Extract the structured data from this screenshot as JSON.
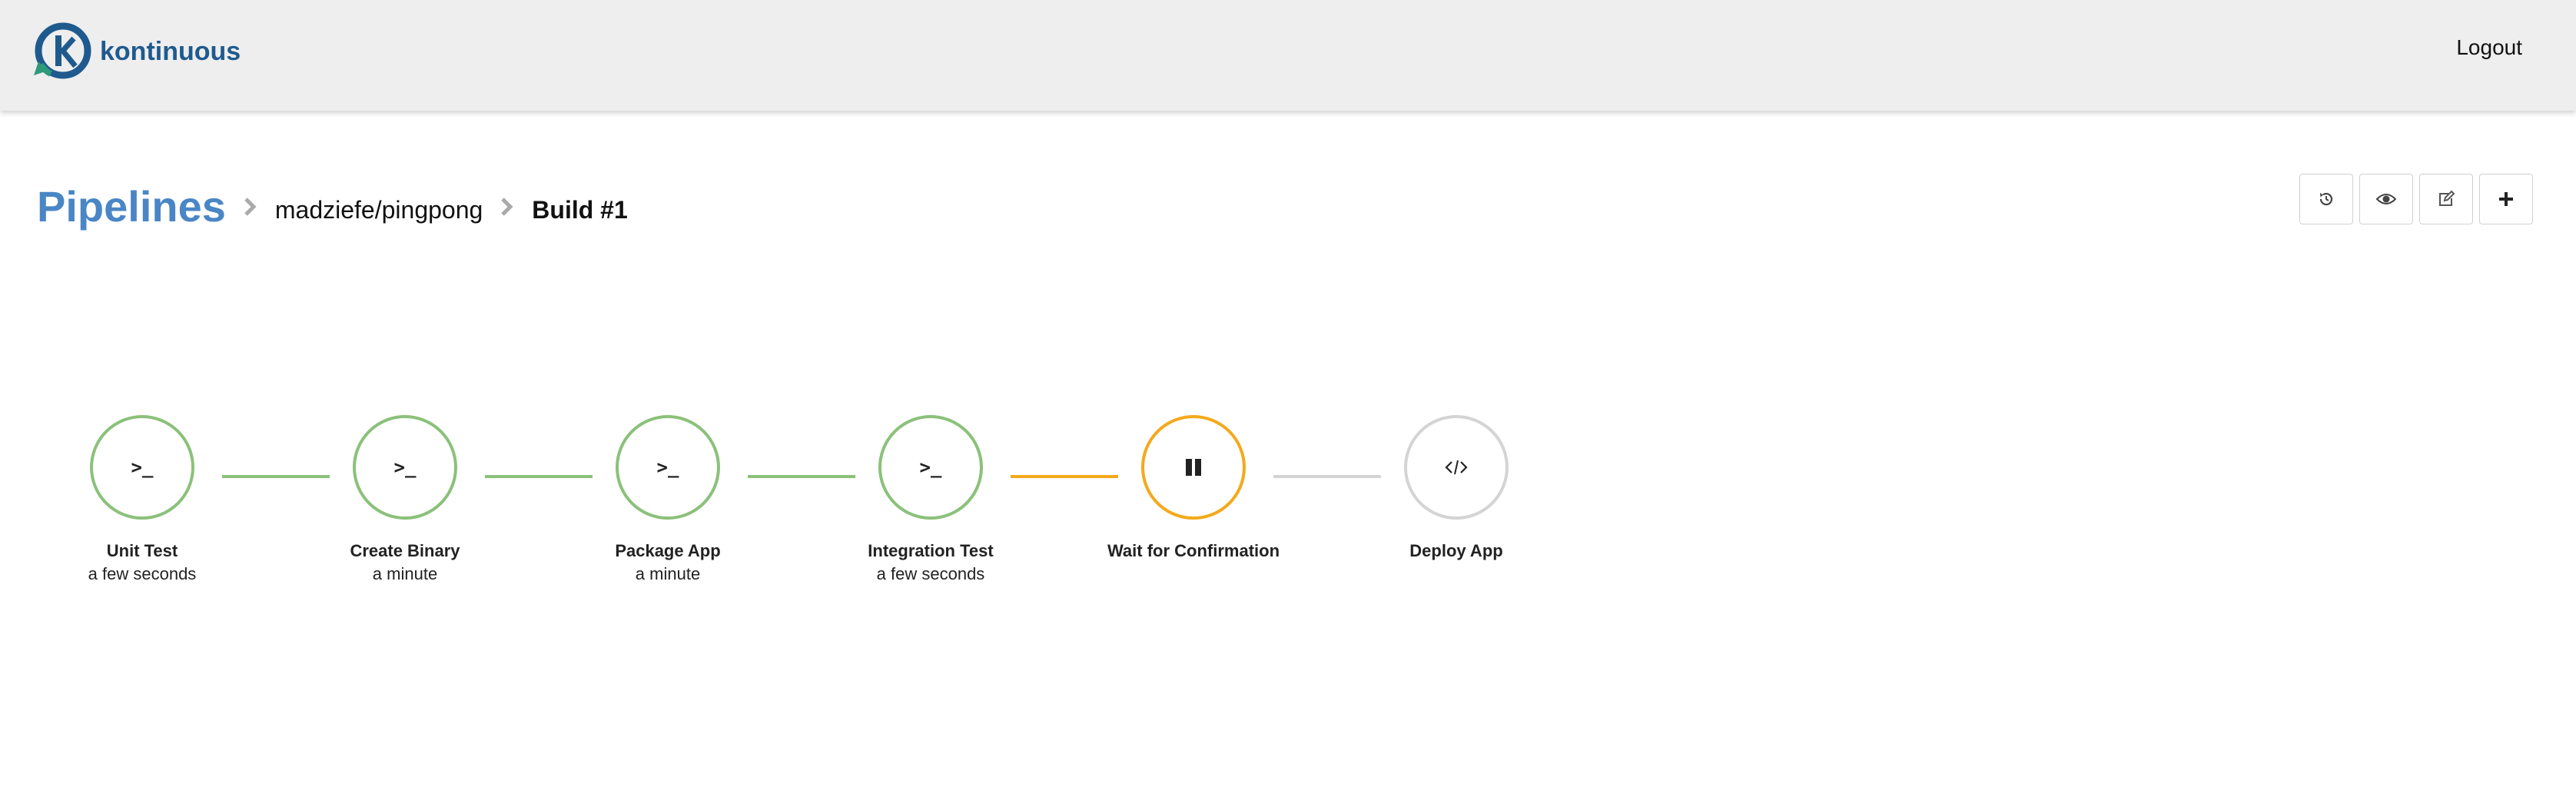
{
  "navbar": {
    "brand_name": "kontinuous",
    "logout_label": "Logout"
  },
  "breadcrumb": {
    "root": "Pipelines",
    "repo": "madziefe/pingpong",
    "build": "Build #1"
  },
  "toolbar": {
    "buttons": [
      {
        "icon": "history-icon"
      },
      {
        "icon": "eye-icon"
      },
      {
        "icon": "edit-icon"
      },
      {
        "icon": "plus-icon"
      }
    ]
  },
  "stages": [
    {
      "name": "Unit Test",
      "time": "a few seconds",
      "status": "success",
      "icon": "terminal-icon"
    },
    {
      "name": "Create Binary",
      "time": "a minute",
      "status": "success",
      "icon": "terminal-icon"
    },
    {
      "name": "Package App",
      "time": "a minute",
      "status": "success",
      "icon": "terminal-icon"
    },
    {
      "name": "Integration Test",
      "time": "a few seconds",
      "status": "success",
      "icon": "terminal-icon"
    },
    {
      "name": "Wait for Confirmation",
      "time": "",
      "status": "paused",
      "icon": "pause-icon"
    },
    {
      "name": "Deploy App",
      "time": "",
      "status": "pending",
      "icon": "code-icon"
    }
  ],
  "colors": {
    "success": "#8bc17a",
    "paused": "#f4a91c",
    "pending": "#d4d4d4",
    "brand": "#1f5a8e",
    "link": "#4a86c5"
  }
}
